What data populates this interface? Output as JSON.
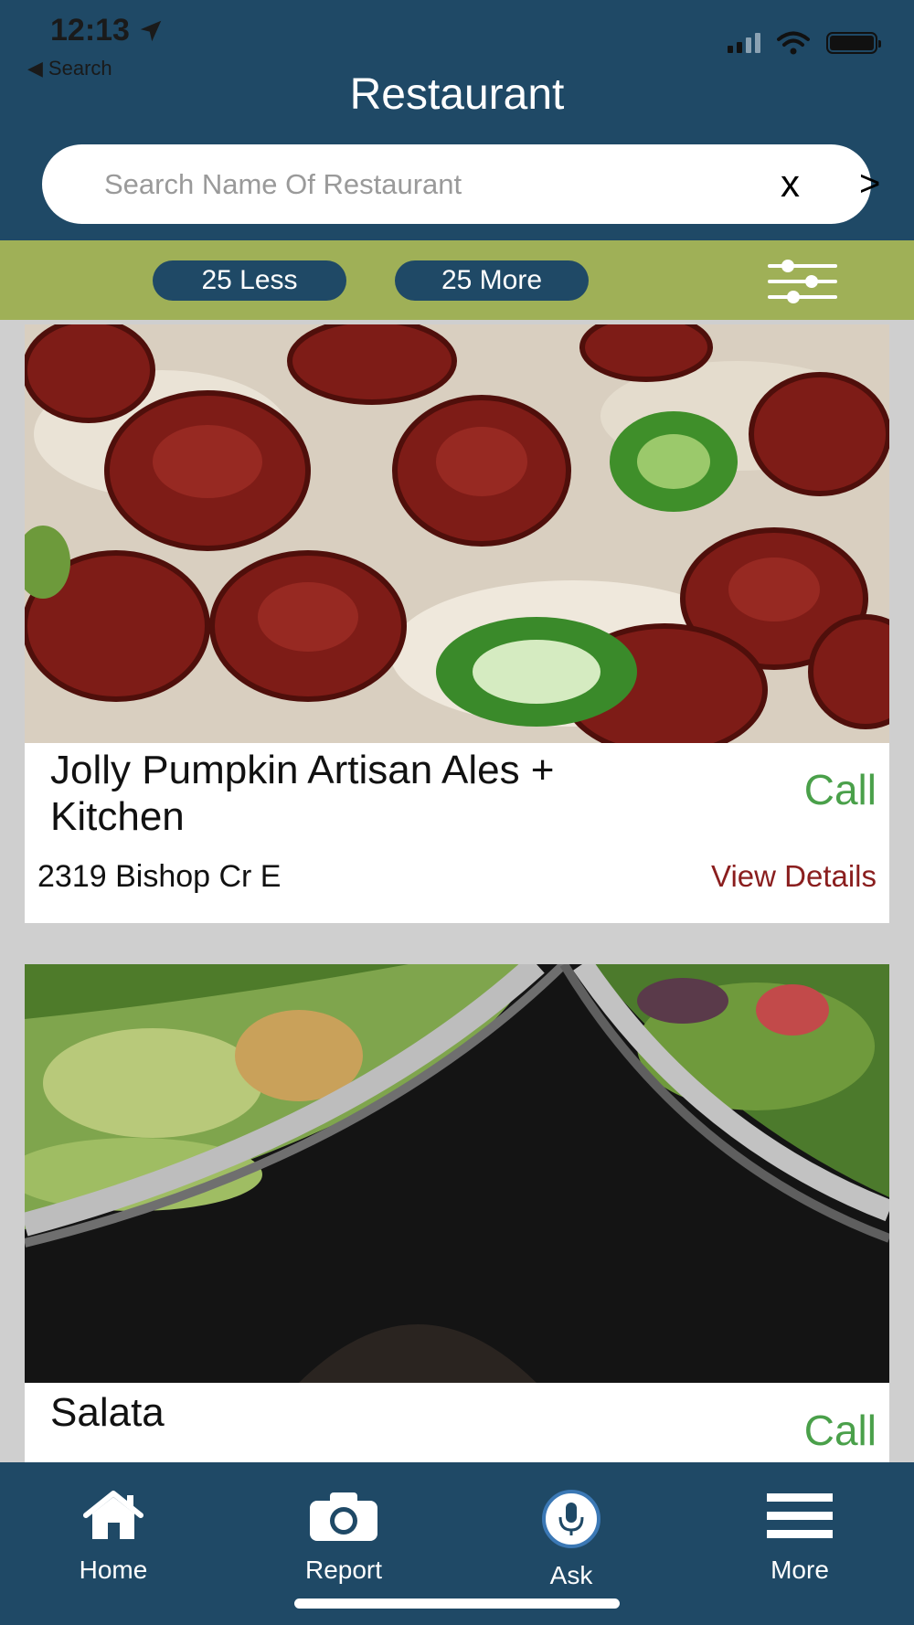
{
  "status_bar": {
    "time": "12:13",
    "back_label": "Search"
  },
  "header": {
    "title": "Restaurant"
  },
  "search": {
    "placeholder": "Search Name Of Restaurant",
    "value": "",
    "clear_label": "x",
    "go_label": ">"
  },
  "filters": {
    "less_label": "25 Less",
    "more_label": "25 More"
  },
  "restaurants": [
    {
      "name": "Jolly Pumpkin Artisan Ales + Kitchen",
      "address": "2319 Bishop Cr E",
      "call_label": "Call",
      "details_label": "View Details"
    },
    {
      "name": "Salata",
      "call_label": "Call"
    }
  ],
  "nav": {
    "home": "Home",
    "report": "Report",
    "ask": "Ask",
    "more": "More"
  },
  "colors": {
    "header": "#1f4966",
    "filter_bar": "#9fb057",
    "call": "#4aa04a",
    "view_details": "#8a1e1e"
  },
  "icons": {
    "location": "location-arrow-icon",
    "filter": "sliders-icon",
    "home": "home-icon",
    "report": "camera-icon",
    "ask": "microphone-icon",
    "more": "hamburger-menu-icon"
  }
}
